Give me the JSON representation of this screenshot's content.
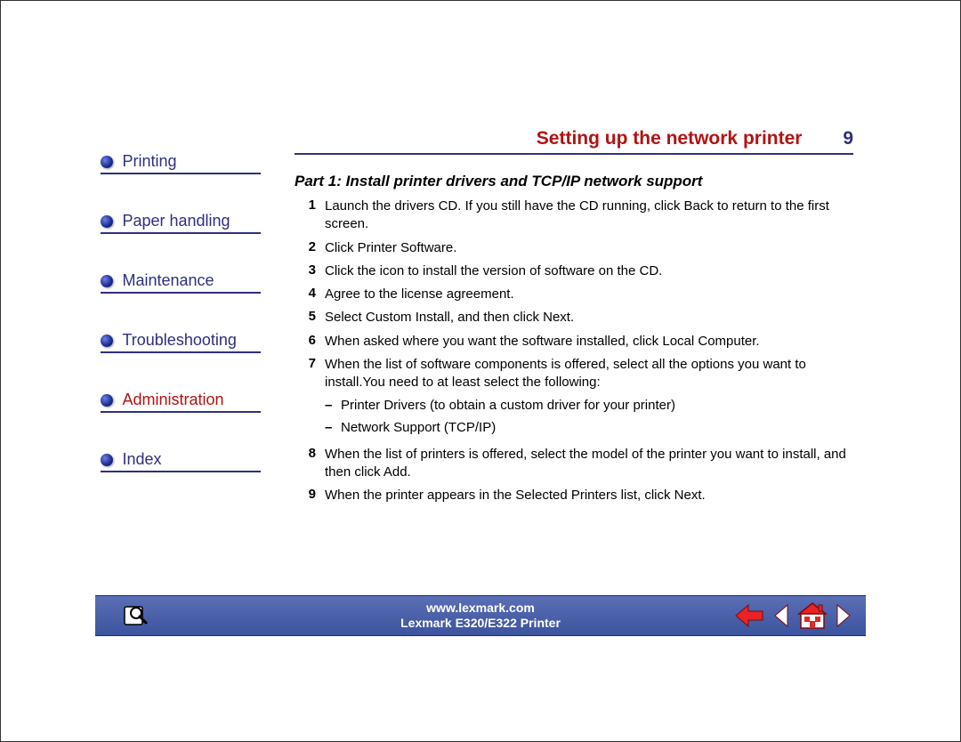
{
  "header": {
    "title": "Setting up the network printer",
    "page_number": "9"
  },
  "sidebar": {
    "items": [
      {
        "label": "Printing",
        "active": false
      },
      {
        "label": "Paper handling",
        "active": false
      },
      {
        "label": "Maintenance",
        "active": false
      },
      {
        "label": "Troubleshooting",
        "active": false
      },
      {
        "label": "Administration",
        "active": true
      },
      {
        "label": "Index",
        "active": false
      }
    ]
  },
  "content": {
    "part_heading": "Part 1: Install printer drivers and TCP/IP network support",
    "steps": [
      {
        "n": "1",
        "text": "Launch the drivers CD. If you still have the CD running, click Back to return to the first screen."
      },
      {
        "n": "2",
        "text": "Click Printer Software."
      },
      {
        "n": "3",
        "text": "Click the icon to install the version of software on the CD."
      },
      {
        "n": "4",
        "text": "Agree to the license agreement."
      },
      {
        "n": "5",
        "text": "Select Custom Install, and then click Next."
      },
      {
        "n": "6",
        "text": "When asked where you want the software installed, click Local Computer."
      },
      {
        "n": "7",
        "text": "When the list of software components is offered, select all the options you want to install.You need to at least select the following:",
        "sub": [
          "Printer Drivers (to obtain a custom driver for your printer)",
          "Network Support (TCP/IP)"
        ]
      },
      {
        "n": "8",
        "text": "When the list of printers is offered, select the model of the printer you want to install, and then click Add."
      },
      {
        "n": "9",
        "text": "When the printer appears in the Selected Printers list, click Next."
      }
    ]
  },
  "footer": {
    "url": "www.lexmark.com",
    "model": "Lexmark E320/E322 Printer"
  },
  "icons": {
    "search": "search-icon",
    "back_arrow": "back-arrow-icon",
    "prev": "prev-page-icon",
    "home": "home-icon",
    "next": "next-page-icon"
  }
}
